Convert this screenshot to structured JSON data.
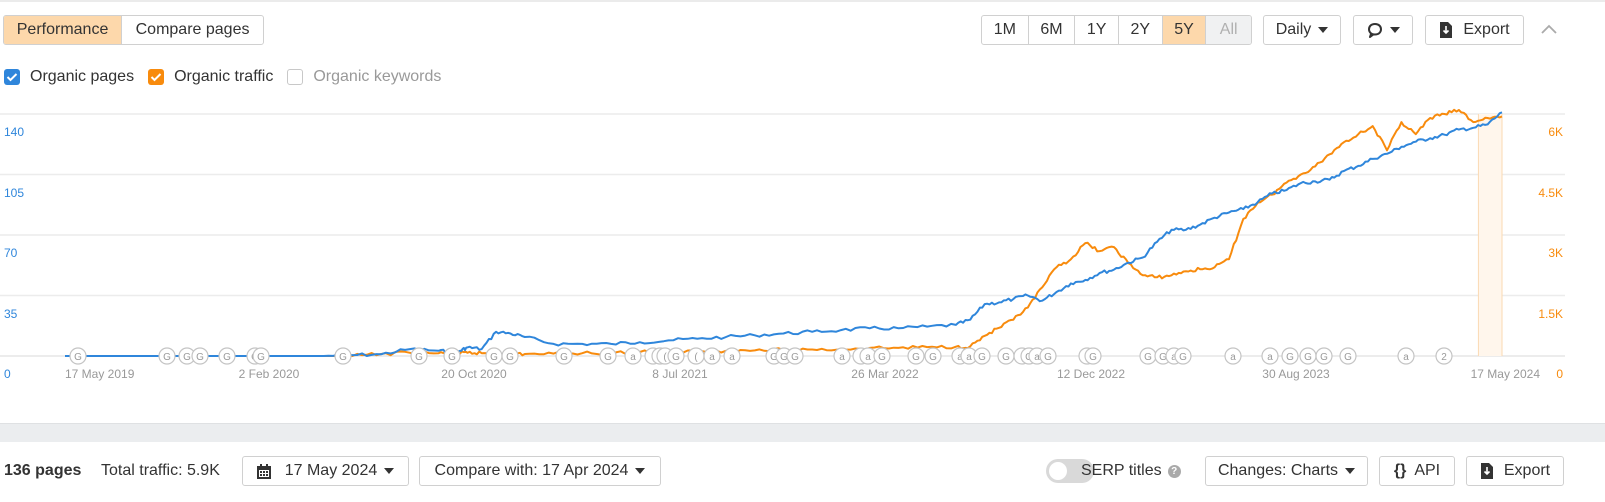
{
  "tabs": [
    {
      "label": "Performance",
      "active": true
    },
    {
      "label": "Compare pages",
      "active": false
    }
  ],
  "range": {
    "options": [
      {
        "label": "1M",
        "state": "normal"
      },
      {
        "label": "6M",
        "state": "normal"
      },
      {
        "label": "1Y",
        "state": "normal"
      },
      {
        "label": "2Y",
        "state": "normal"
      },
      {
        "label": "5Y",
        "state": "active"
      },
      {
        "label": "All",
        "state": "disabled"
      }
    ]
  },
  "toolbar": {
    "interval_label": "Daily",
    "annotations_icon": "speech-bubble-icon",
    "export_label": "Export",
    "collapse_icon": "chevron-up-icon"
  },
  "legend": [
    {
      "label": "Organic pages",
      "checked": true,
      "color": "#2f86db"
    },
    {
      "label": "Organic traffic",
      "checked": true,
      "color": "#f88b0d"
    },
    {
      "label": "Organic keywords",
      "checked": false,
      "color": "#c8c8c8"
    }
  ],
  "chart_data": {
    "type": "line",
    "title": "",
    "x_start": "17 May 2019",
    "x_end": "17 May 2024",
    "x_tick_labels": [
      "17 May 2019",
      "2 Feb 2020",
      "20 Oct 2020",
      "8 Jul 2021",
      "26 Mar 2022",
      "12 Dec 2022",
      "30 Aug 2023",
      "17 May 2024"
    ],
    "y_left": {
      "label": "Organic pages",
      "ticks": [
        "0",
        "35",
        "70",
        "105",
        "140"
      ],
      "range": [
        0,
        140
      ]
    },
    "y_right": {
      "label": "Organic traffic",
      "ticks": [
        "0",
        "1.5K",
        "3K",
        "4.5K",
        "6K"
      ],
      "range": [
        0,
        6000
      ]
    },
    "grid": true,
    "highlight_range": [
      "17 Apr 2024",
      "17 May 2024"
    ],
    "x_fraction": [
      0.0,
      0.06,
      0.12,
      0.18,
      0.2,
      0.22,
      0.24,
      0.26,
      0.27,
      0.275,
      0.28,
      0.29,
      0.3,
      0.31,
      0.32,
      0.34,
      0.36,
      0.38,
      0.4,
      0.42,
      0.44,
      0.46,
      0.48,
      0.5,
      0.52,
      0.54,
      0.56,
      0.58,
      0.6,
      0.62,
      0.63,
      0.64,
      0.65,
      0.66,
      0.67,
      0.68,
      0.69,
      0.7,
      0.71,
      0.72,
      0.73,
      0.74,
      0.75,
      0.76,
      0.77,
      0.78,
      0.79,
      0.8,
      0.81,
      0.82,
      0.83,
      0.84,
      0.85,
      0.86,
      0.87,
      0.88,
      0.89,
      0.9,
      0.91,
      0.92,
      0.93,
      0.94,
      0.95,
      0.96,
      0.97,
      0.98,
      0.99,
      1.0
    ],
    "series": [
      {
        "name": "Organic pages",
        "color": "#2f86db",
        "axis": "left",
        "values": [
          0,
          0,
          0,
          0,
          0.5,
          1,
          4,
          3,
          2,
          3,
          5,
          4,
          14,
          13,
          11,
          7,
          7,
          7,
          8,
          9,
          10,
          11,
          12,
          13,
          14,
          15,
          16,
          16,
          17,
          18,
          21,
          30,
          31,
          33,
          35,
          32,
          37,
          42,
          44,
          48,
          50,
          54,
          57,
          66,
          73,
          73,
          76,
          80,
          83,
          85,
          89,
          94,
          96,
          100,
          101,
          102,
          107,
          110,
          114,
          117,
          121,
          124,
          126,
          128,
          131,
          132,
          134,
          141
        ]
      },
      {
        "name": "Organic traffic",
        "color": "#f88b0d",
        "axis": "right",
        "values": [
          0,
          0,
          0,
          0,
          0,
          50,
          80,
          70,
          60,
          60,
          80,
          70,
          80,
          60,
          50,
          60,
          70,
          80,
          100,
          110,
          120,
          130,
          140,
          150,
          160,
          170,
          200,
          200,
          220,
          230,
          240,
          500,
          700,
          900,
          1200,
          1700,
          2200,
          2400,
          2800,
          2600,
          2700,
          2300,
          2000,
          1950,
          2000,
          2100,
          2150,
          2200,
          2400,
          3400,
          3800,
          4000,
          4300,
          4500,
          4700,
          5000,
          5300,
          5500,
          5700,
          5100,
          5800,
          5500,
          5900,
          6000,
          6100,
          5800,
          5900,
          5940
        ]
      }
    ],
    "event_markers": [
      "G",
      "G",
      "G",
      "G",
      "G",
      "G",
      "G",
      "G",
      "G",
      "G",
      "G",
      "G",
      "G",
      "a",
      "a",
      "a",
      "a",
      "2"
    ]
  },
  "footer": {
    "pages_count": "136 pages",
    "total_traffic": "Total traffic: 5.9K",
    "date_label": "17 May 2024",
    "compare_label": "Compare with: 17 Apr 2024",
    "serp_titles_label": "SERP titles",
    "serp_titles_on": false,
    "help_glyph": "?",
    "changes_label": "Changes: Charts",
    "api_label": "API",
    "api_glyph": "{}",
    "export_label": "Export"
  }
}
